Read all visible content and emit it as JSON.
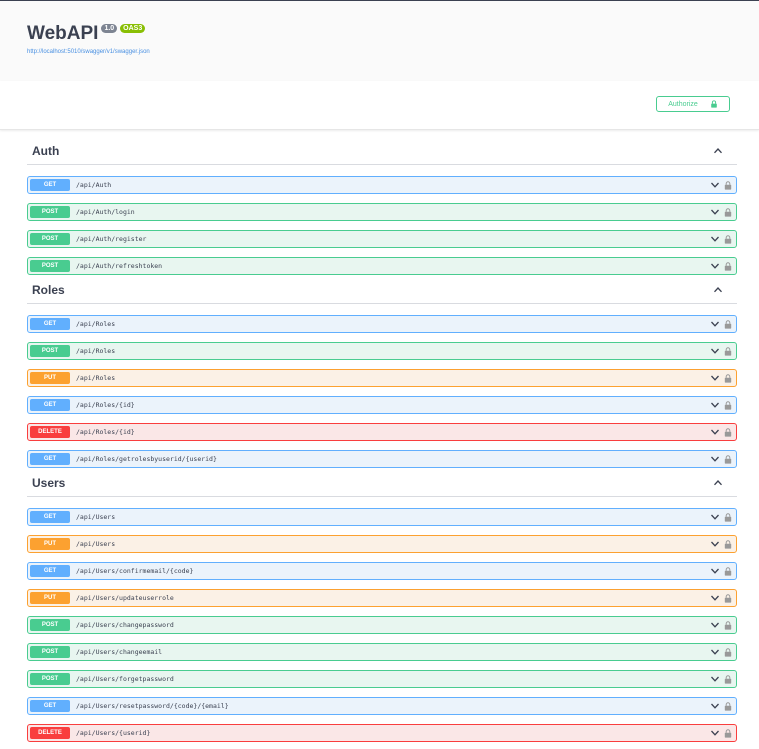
{
  "info": {
    "title": "WebAPI",
    "version": "1.0",
    "oas": "OAS3",
    "spec_url": "http://localhost:5010/swagger/v1/swagger.json"
  },
  "authorize_label": "Authorize",
  "sections": [
    {
      "name": "Auth",
      "ops": [
        {
          "method": "GET",
          "path": "/api/Auth"
        },
        {
          "method": "POST",
          "path": "/api/Auth/login"
        },
        {
          "method": "POST",
          "path": "/api/Auth/register"
        },
        {
          "method": "POST",
          "path": "/api/Auth/refreshtoken"
        }
      ]
    },
    {
      "name": "Roles",
      "ops": [
        {
          "method": "GET",
          "path": "/api/Roles"
        },
        {
          "method": "POST",
          "path": "/api/Roles"
        },
        {
          "method": "PUT",
          "path": "/api/Roles"
        },
        {
          "method": "GET",
          "path": "/api/Roles/{id}"
        },
        {
          "method": "DELETE",
          "path": "/api/Roles/{id}"
        },
        {
          "method": "GET",
          "path": "/api/Roles/getrolesbyuserid/{userid}"
        }
      ]
    },
    {
      "name": "Users",
      "ops": [
        {
          "method": "GET",
          "path": "/api/Users"
        },
        {
          "method": "PUT",
          "path": "/api/Users"
        },
        {
          "method": "GET",
          "path": "/api/Users/confirmemail/{code}"
        },
        {
          "method": "PUT",
          "path": "/api/Users/updateuserrole"
        },
        {
          "method": "POST",
          "path": "/api/Users/changepassword"
        },
        {
          "method": "POST",
          "path": "/api/Users/changeemail"
        },
        {
          "method": "POST",
          "path": "/api/Users/forgetpassword"
        },
        {
          "method": "GET",
          "path": "/api/Users/resetpassword/{code}/{email}"
        },
        {
          "method": "DELETE",
          "path": "/api/Users/{userid}"
        }
      ]
    }
  ],
  "icons": {
    "lock": "lock-icon",
    "chevron_down": "chevron-down-icon",
    "chevron_up": "chevron-up-icon"
  },
  "colors": {
    "get": "#61affe",
    "post": "#49cc90",
    "put": "#fca130",
    "delete": "#f93e3e"
  }
}
